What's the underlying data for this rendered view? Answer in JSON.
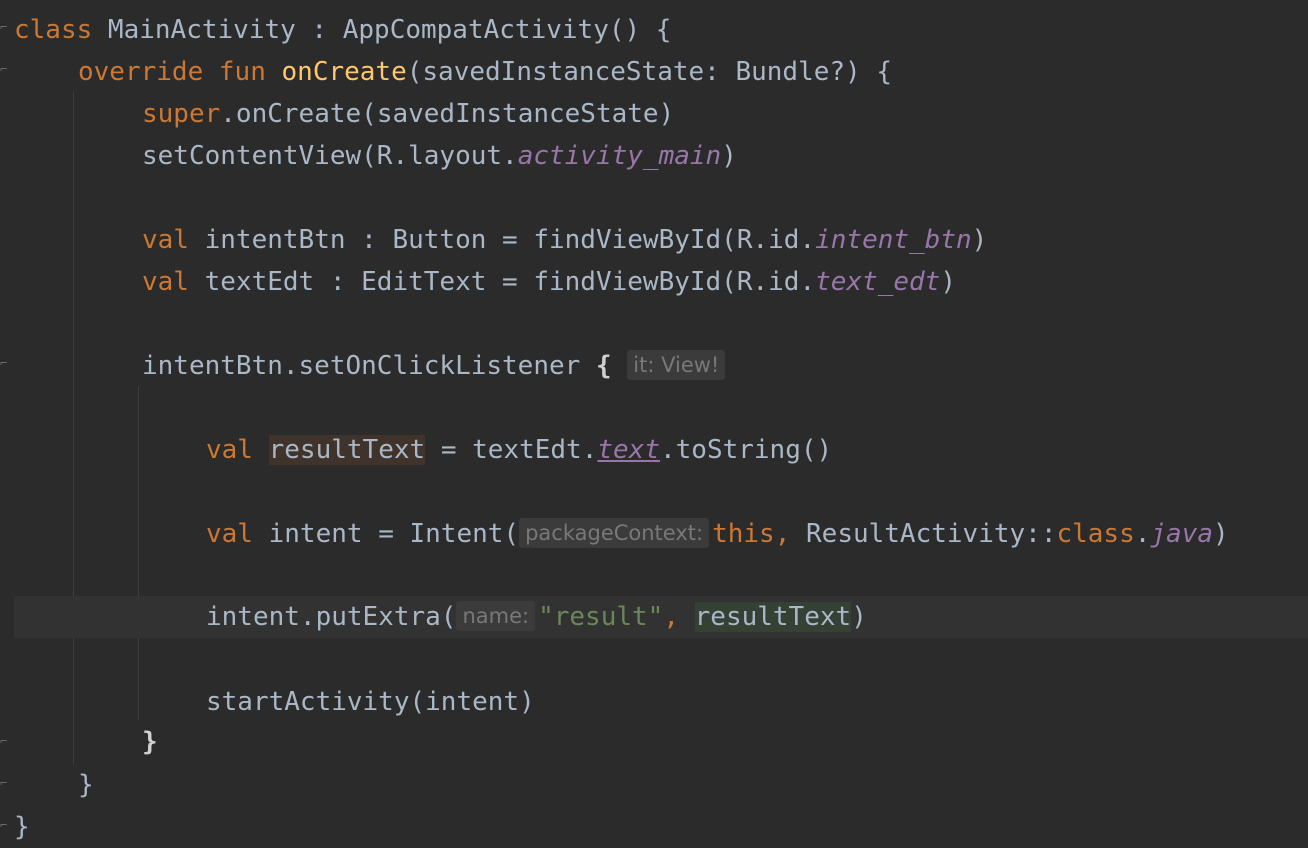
{
  "code": {
    "l1": {
      "kw_class": "class",
      "name": " MainActivity : AppCompatActivity() {"
    },
    "l2": {
      "kw_override": "override",
      "kw_fun": " fun ",
      "fn_name": "onCreate",
      "rest": "(savedInstanceState: Bundle?) {"
    },
    "l3": {
      "kw_super": "super",
      "rest": ".onCreate(savedInstanceState)"
    },
    "l4": {
      "pre": "setContentView(R.layout.",
      "ref": "activity_main",
      "post": ")"
    },
    "l5": {
      "kw_val": "val",
      "pre": " intentBtn : Button = findViewById(R.id.",
      "ref": "intent_btn",
      "post": ")"
    },
    "l6": {
      "kw_val": "val",
      "pre": " textEdt : EditText = findViewById(R.id.",
      "ref": "text_edt",
      "post": ")"
    },
    "l7": {
      "pre": "intentBtn.setOnClickListener ",
      "brace": "{",
      "hint": "it: View!"
    },
    "l8": {
      "kw_val": "val",
      "sp": " ",
      "var": "resultText",
      "mid": " = textEdt.",
      "prop": "text",
      "post": ".toString()"
    },
    "l9": {
      "kw_val": "val",
      "pre": " intent = Intent(",
      "hint": "packageContext:",
      "kw_this": "this,",
      "mid": " ResultActivity::",
      "kw_class": "class",
      "dot": ".",
      "prop": "java",
      "post": ")"
    },
    "l10": {
      "pre": "intent.putExtra(",
      "hint": "name:",
      "str": "\"result\"",
      "comma": ", ",
      "var": "resultText",
      "post": ")"
    },
    "l11": {
      "text": "startActivity(intent)"
    },
    "l12": {
      "text": "}"
    },
    "l13": {
      "text": "}"
    },
    "l14": {
      "text": "}"
    }
  },
  "colors": {
    "background": "#2b2b2b",
    "keyword": "#cc7832",
    "function": "#ffc66d",
    "string": "#6a8759",
    "field": "#9876aa",
    "default": "#a9b7c6"
  }
}
